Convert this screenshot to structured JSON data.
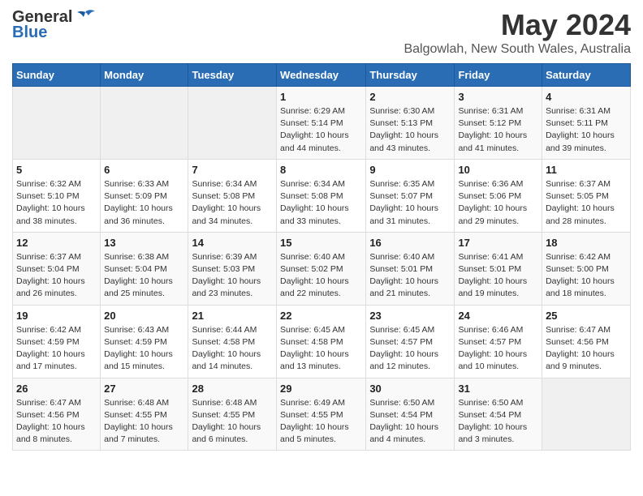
{
  "header": {
    "logo_general": "General",
    "logo_blue": "Blue",
    "title": "May 2024",
    "subtitle": "Balgowlah, New South Wales, Australia"
  },
  "days_of_week": [
    "Sunday",
    "Monday",
    "Tuesday",
    "Wednesday",
    "Thursday",
    "Friday",
    "Saturday"
  ],
  "weeks": [
    [
      {
        "day": "",
        "empty": true
      },
      {
        "day": "",
        "empty": true
      },
      {
        "day": "",
        "empty": true
      },
      {
        "day": "1",
        "sunrise": "6:29 AM",
        "sunset": "5:14 PM",
        "daylight": "10 hours and 44 minutes."
      },
      {
        "day": "2",
        "sunrise": "6:30 AM",
        "sunset": "5:13 PM",
        "daylight": "10 hours and 43 minutes."
      },
      {
        "day": "3",
        "sunrise": "6:31 AM",
        "sunset": "5:12 PM",
        "daylight": "10 hours and 41 minutes."
      },
      {
        "day": "4",
        "sunrise": "6:31 AM",
        "sunset": "5:11 PM",
        "daylight": "10 hours and 39 minutes."
      }
    ],
    [
      {
        "day": "5",
        "sunrise": "6:32 AM",
        "sunset": "5:10 PM",
        "daylight": "10 hours and 38 minutes."
      },
      {
        "day": "6",
        "sunrise": "6:33 AM",
        "sunset": "5:09 PM",
        "daylight": "10 hours and 36 minutes."
      },
      {
        "day": "7",
        "sunrise": "6:34 AM",
        "sunset": "5:08 PM",
        "daylight": "10 hours and 34 minutes."
      },
      {
        "day": "8",
        "sunrise": "6:34 AM",
        "sunset": "5:08 PM",
        "daylight": "10 hours and 33 minutes."
      },
      {
        "day": "9",
        "sunrise": "6:35 AM",
        "sunset": "5:07 PM",
        "daylight": "10 hours and 31 minutes."
      },
      {
        "day": "10",
        "sunrise": "6:36 AM",
        "sunset": "5:06 PM",
        "daylight": "10 hours and 29 minutes."
      },
      {
        "day": "11",
        "sunrise": "6:37 AM",
        "sunset": "5:05 PM",
        "daylight": "10 hours and 28 minutes."
      }
    ],
    [
      {
        "day": "12",
        "sunrise": "6:37 AM",
        "sunset": "5:04 PM",
        "daylight": "10 hours and 26 minutes."
      },
      {
        "day": "13",
        "sunrise": "6:38 AM",
        "sunset": "5:04 PM",
        "daylight": "10 hours and 25 minutes."
      },
      {
        "day": "14",
        "sunrise": "6:39 AM",
        "sunset": "5:03 PM",
        "daylight": "10 hours and 23 minutes."
      },
      {
        "day": "15",
        "sunrise": "6:40 AM",
        "sunset": "5:02 PM",
        "daylight": "10 hours and 22 minutes."
      },
      {
        "day": "16",
        "sunrise": "6:40 AM",
        "sunset": "5:01 PM",
        "daylight": "10 hours and 21 minutes."
      },
      {
        "day": "17",
        "sunrise": "6:41 AM",
        "sunset": "5:01 PM",
        "daylight": "10 hours and 19 minutes."
      },
      {
        "day": "18",
        "sunrise": "6:42 AM",
        "sunset": "5:00 PM",
        "daylight": "10 hours and 18 minutes."
      }
    ],
    [
      {
        "day": "19",
        "sunrise": "6:42 AM",
        "sunset": "4:59 PM",
        "daylight": "10 hours and 17 minutes."
      },
      {
        "day": "20",
        "sunrise": "6:43 AM",
        "sunset": "4:59 PM",
        "daylight": "10 hours and 15 minutes."
      },
      {
        "day": "21",
        "sunrise": "6:44 AM",
        "sunset": "4:58 PM",
        "daylight": "10 hours and 14 minutes."
      },
      {
        "day": "22",
        "sunrise": "6:45 AM",
        "sunset": "4:58 PM",
        "daylight": "10 hours and 13 minutes."
      },
      {
        "day": "23",
        "sunrise": "6:45 AM",
        "sunset": "4:57 PM",
        "daylight": "10 hours and 12 minutes."
      },
      {
        "day": "24",
        "sunrise": "6:46 AM",
        "sunset": "4:57 PM",
        "daylight": "10 hours and 10 minutes."
      },
      {
        "day": "25",
        "sunrise": "6:47 AM",
        "sunset": "4:56 PM",
        "daylight": "10 hours and 9 minutes."
      }
    ],
    [
      {
        "day": "26",
        "sunrise": "6:47 AM",
        "sunset": "4:56 PM",
        "daylight": "10 hours and 8 minutes."
      },
      {
        "day": "27",
        "sunrise": "6:48 AM",
        "sunset": "4:55 PM",
        "daylight": "10 hours and 7 minutes."
      },
      {
        "day": "28",
        "sunrise": "6:48 AM",
        "sunset": "4:55 PM",
        "daylight": "10 hours and 6 minutes."
      },
      {
        "day": "29",
        "sunrise": "6:49 AM",
        "sunset": "4:55 PM",
        "daylight": "10 hours and 5 minutes."
      },
      {
        "day": "30",
        "sunrise": "6:50 AM",
        "sunset": "4:54 PM",
        "daylight": "10 hours and 4 minutes."
      },
      {
        "day": "31",
        "sunrise": "6:50 AM",
        "sunset": "4:54 PM",
        "daylight": "10 hours and 3 minutes."
      },
      {
        "day": "",
        "empty": true
      }
    ]
  ],
  "labels": {
    "sunrise_label": "Sunrise:",
    "sunset_label": "Sunset:",
    "daylight_label": "Daylight:"
  }
}
